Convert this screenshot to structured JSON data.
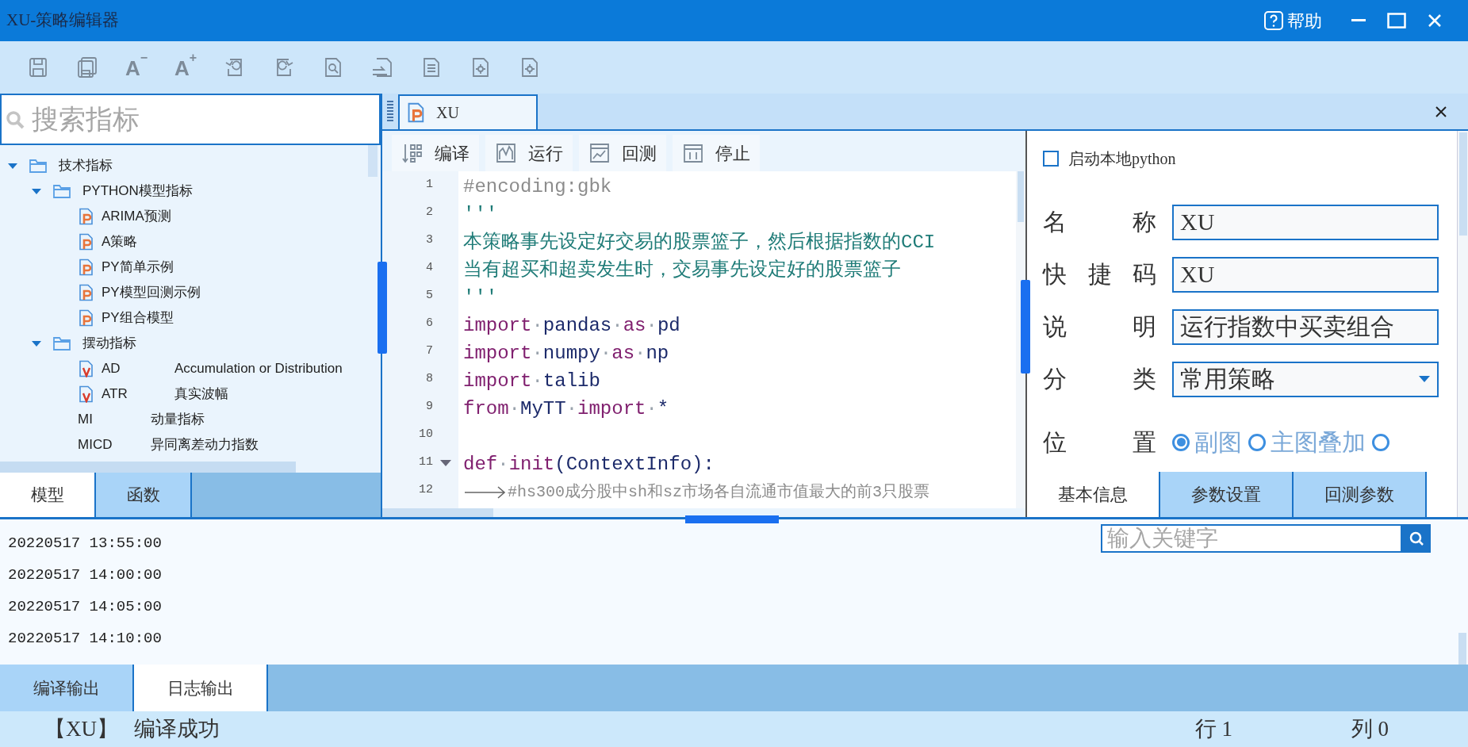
{
  "window": {
    "title": "XU-策略编辑器",
    "help": "帮助"
  },
  "toolbar": [
    {
      "kind": "save"
    },
    {
      "kind": "save_all"
    },
    {
      "kind": "font",
      "label": "A",
      "sign": "−"
    },
    {
      "kind": "font",
      "label": "A",
      "sign": "+"
    },
    {
      "kind": "undo"
    },
    {
      "kind": "redo"
    },
    {
      "kind": "find"
    },
    {
      "kind": "replace"
    },
    {
      "kind": "list"
    },
    {
      "kind": "gear_doc"
    },
    {
      "kind": "gear_doc"
    }
  ],
  "search": {
    "placeholder": "搜索指标"
  },
  "tree": [
    {
      "kind": "folder",
      "label": "技术指标",
      "expanded": true,
      "children": [
        {
          "kind": "folder",
          "label": "PYTHON模型指标",
          "expanded": true,
          "children": [
            {
              "kind": "py",
              "code": "ARIMA预测"
            },
            {
              "kind": "py",
              "code": "A策略"
            },
            {
              "kind": "py",
              "code": "PY简单示例"
            },
            {
              "kind": "py",
              "code": "PY模型回测示例"
            },
            {
              "kind": "py",
              "code": "PY组合模型"
            }
          ]
        },
        {
          "kind": "folder",
          "label": "摆动指标",
          "expanded": true,
          "children": [
            {
              "kind": "v",
              "code": "AD",
              "desc": "Accumulation or Distribution"
            },
            {
              "kind": "v",
              "code": "ATR",
              "desc": "真实波幅"
            },
            {
              "kind": "plain",
              "code": "MI",
              "desc": "动量指标"
            },
            {
              "kind": "plain",
              "code": "MICD",
              "desc": "异同离差动力指数"
            }
          ]
        }
      ]
    }
  ],
  "left_tabs": [
    {
      "label": "模型",
      "selected": true
    },
    {
      "label": "函数",
      "selected": false
    }
  ],
  "editor": {
    "tabs": [
      {
        "label": "XU",
        "selected": true
      }
    ],
    "toolbar": [
      {
        "kind": "compile",
        "label": "编译"
      },
      {
        "kind": "run",
        "label": "运行"
      },
      {
        "kind": "backtest",
        "label": "回测"
      },
      {
        "kind": "stop",
        "label": "停止"
      }
    ],
    "lines": [
      {
        "number": "1",
        "fold": false,
        "tokens": [
          {
            "kind": "comment",
            "text": "#encoding:gbk"
          }
        ]
      },
      {
        "number": "2",
        "fold": false,
        "tokens": [
          {
            "kind": "string",
            "text": "'''"
          }
        ]
      },
      {
        "number": "3",
        "fold": false,
        "tokens": [
          {
            "kind": "string",
            "text": "本策略事先设定好交易的股票篮子，然后根据指数的CCI"
          }
        ]
      },
      {
        "number": "4",
        "fold": false,
        "tokens": [
          {
            "kind": "string",
            "text": "当有超买和超卖发生时，交易事先设定好的股票篮子"
          }
        ]
      },
      {
        "number": "5",
        "fold": false,
        "tokens": [
          {
            "kind": "string",
            "text": "'''"
          }
        ]
      },
      {
        "number": "6",
        "fold": false,
        "tokens": [
          {
            "kind": "keyword",
            "text": "import"
          },
          {
            "kind": "space",
            "text": "·"
          },
          {
            "kind": "name",
            "text": "pandas"
          },
          {
            "kind": "space",
            "text": "·"
          },
          {
            "kind": "keyword",
            "text": "as"
          },
          {
            "kind": "space",
            "text": "·"
          },
          {
            "kind": "name",
            "text": "pd"
          }
        ]
      },
      {
        "number": "7",
        "fold": false,
        "tokens": [
          {
            "kind": "keyword",
            "text": "import"
          },
          {
            "kind": "space",
            "text": "·"
          },
          {
            "kind": "name",
            "text": "numpy"
          },
          {
            "kind": "space",
            "text": "·"
          },
          {
            "kind": "keyword",
            "text": "as"
          },
          {
            "kind": "space",
            "text": "·"
          },
          {
            "kind": "name",
            "text": "np"
          }
        ]
      },
      {
        "number": "8",
        "fold": false,
        "tokens": [
          {
            "kind": "keyword",
            "text": "import"
          },
          {
            "kind": "space",
            "text": "·"
          },
          {
            "kind": "name",
            "text": "talib"
          }
        ]
      },
      {
        "number": "9",
        "fold": false,
        "tokens": [
          {
            "kind": "keyword",
            "text": "from"
          },
          {
            "kind": "space",
            "text": "·"
          },
          {
            "kind": "name",
            "text": "MyTT"
          },
          {
            "kind": "space",
            "text": "·"
          },
          {
            "kind": "keyword",
            "text": "import"
          },
          {
            "kind": "space",
            "text": "·"
          },
          {
            "kind": "name",
            "text": "*"
          }
        ]
      },
      {
        "number": "10",
        "fold": false
      },
      {
        "number": "11",
        "fold": true,
        "tokens": [
          {
            "kind": "keyword",
            "text": "def"
          },
          {
            "kind": "space",
            "text": "·"
          },
          {
            "kind": "keyword",
            "text": "init"
          },
          {
            "kind": "name",
            "text": "(ContextInfo):"
          }
        ]
      },
      {
        "number": "12",
        "fold": false,
        "tokens": [
          {
            "kind": "tab"
          },
          {
            "kind": "small_comment",
            "text": "#hs300成分股中sh和sz市场各自流通市值最大的前3只股票"
          }
        ]
      }
    ]
  },
  "properties": {
    "local_python": {
      "label": "启动本地python",
      "checked": false
    },
    "fields": [
      {
        "kind": "text",
        "label": "名称",
        "value": "XU"
      },
      {
        "kind": "text",
        "label": "快捷码",
        "value": "XU"
      },
      {
        "kind": "text",
        "label": "说明",
        "value": "运行指数中买卖组合"
      },
      {
        "kind": "select",
        "label": "分类",
        "value": "常用策略"
      },
      {
        "kind": "radio",
        "label": "位置",
        "options": [
          {
            "label": "副图",
            "selected": true
          },
          {
            "label": "主图叠加",
            "selected": false
          },
          {
            "selected": false
          }
        ]
      }
    ],
    "tabs": [
      {
        "label": "基本信息",
        "selected": true
      },
      {
        "label": "参数设置",
        "selected": false
      },
      {
        "label": "回测参数",
        "selected": false
      }
    ]
  },
  "log": {
    "lines": [
      "20220517 13:55:00",
      "20220517 14:00:00",
      "20220517 14:05:00",
      "20220517 14:10:00"
    ],
    "search": {
      "placeholder": "输入关键字"
    }
  },
  "bottom_tabs": [
    {
      "label": "编译输出",
      "selected": false
    },
    {
      "label": "日志输出",
      "selected": true
    }
  ],
  "status_bar": {
    "file": "【XU】",
    "message": "编译成功",
    "row": "行 1",
    "col": "列 0"
  }
}
